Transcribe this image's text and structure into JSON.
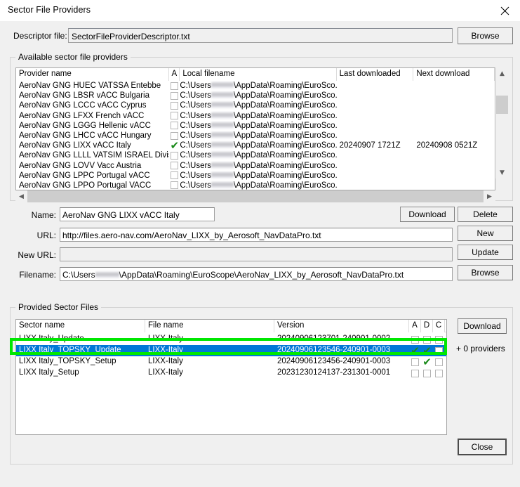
{
  "window": {
    "title": "Sector File Providers",
    "close_icon": "close-icon"
  },
  "descriptor": {
    "label": "Descriptor file:",
    "value": "SectorFileProviderDescriptor.txt",
    "browse_label": "Browse"
  },
  "available_providers": {
    "group_title": "Available sector file providers",
    "columns": [
      "Provider name",
      "A",
      "Local filename",
      "Last downloaded",
      "Next download"
    ],
    "rows": [
      {
        "name": "AeroNav GNG HUEC VATSSA Entebbe",
        "active": false,
        "path_prefix": "C:\\Users",
        "path_suffix": "\\AppData\\Roaming\\EuroSco...",
        "last_downloaded": "",
        "next_download": ""
      },
      {
        "name": "AeroNav GNG LBSR vACC Bulgaria",
        "active": false,
        "path_prefix": "C:\\Users",
        "path_suffix": "\\AppData\\Roaming\\EuroSco...",
        "last_downloaded": "",
        "next_download": ""
      },
      {
        "name": "AeroNav GNG LCCC vACC Cyprus",
        "active": false,
        "path_prefix": "C:\\Users",
        "path_suffix": "\\AppData\\Roaming\\EuroSco...",
        "last_downloaded": "",
        "next_download": ""
      },
      {
        "name": "AeroNav GNG LFXX French vACC",
        "active": false,
        "path_prefix": "C:\\Users",
        "path_suffix": "\\AppData\\Roaming\\EuroSco...",
        "last_downloaded": "",
        "next_download": ""
      },
      {
        "name": "AeroNav GNG LGGG Hellenic vACC",
        "active": false,
        "path_prefix": "C:\\Users",
        "path_suffix": "\\AppData\\Roaming\\EuroSco...",
        "last_downloaded": "",
        "next_download": ""
      },
      {
        "name": "AeroNav GNG LHCC vACC Hungary",
        "active": false,
        "path_prefix": "C:\\Users",
        "path_suffix": "\\AppData\\Roaming\\EuroSco...",
        "last_downloaded": "",
        "next_download": ""
      },
      {
        "name": "AeroNav GNG LIXX vACC Italy",
        "active": true,
        "path_prefix": "C:\\Users",
        "path_suffix": "\\AppData\\Roaming\\EuroSco...",
        "last_downloaded": "20240907 1721Z",
        "next_download": "20240908 0521Z"
      },
      {
        "name": "AeroNav GNG LLLL VATSIM ISRAEL Division",
        "active": false,
        "path_prefix": "C:\\Users",
        "path_suffix": "\\AppData\\Roaming\\EuroSco...",
        "last_downloaded": "",
        "next_download": ""
      },
      {
        "name": "AeroNav GNG LOVV Vacc Austria",
        "active": false,
        "path_prefix": "C:\\Users",
        "path_suffix": "\\AppData\\Roaming\\EuroSco...",
        "last_downloaded": "",
        "next_download": ""
      },
      {
        "name": "AeroNav GNG LPPC Portugal vACC",
        "active": false,
        "path_prefix": "C:\\Users",
        "path_suffix": "\\AppData\\Roaming\\EuroSco...",
        "last_downloaded": "",
        "next_download": ""
      },
      {
        "name": "AeroNav GNG LPPO Portugal VACC",
        "active": false,
        "path_prefix": "C:\\Users",
        "path_suffix": "\\AppData\\Roaming\\EuroSco...",
        "last_downloaded": "",
        "next_download": ""
      }
    ]
  },
  "detail_form": {
    "name_label": "Name:",
    "name_value": "AeroNav GNG LIXX vACC Italy",
    "url_label": "URL:",
    "url_value": "http://files.aero-nav.com/AeroNav_LIXX_by_Aerosoft_NavDataPro.txt",
    "new_url_label": "New URL:",
    "new_url_value": "",
    "filename_label": "Filename:",
    "filename_prefix": "C:\\Users",
    "filename_suffix": "\\AppData\\Roaming\\EuroScope\\AeroNav_LIXX_by_Aerosoft_NavDataPro.txt",
    "buttons": {
      "download": "Download",
      "delete": "Delete",
      "new": "New",
      "update": "Update",
      "browse": "Browse"
    }
  },
  "provided_sector_files": {
    "group_title": "Provided Sector Files",
    "columns": [
      "Sector name",
      "File name",
      "Version",
      "A",
      "D",
      "C"
    ],
    "rows": [
      {
        "sector_name": "LIXX Italy_Update",
        "file_name": "LIXX-Italy",
        "version": "20240906123701-240901-0002",
        "a": false,
        "d": false,
        "c": false,
        "selected": false
      },
      {
        "sector_name": "LIXX Italy_TOPSKY_Update",
        "file_name": "LIXX-Italy",
        "version": "20240906123546-240901-0003",
        "a": true,
        "d": true,
        "c": false,
        "selected": true
      },
      {
        "sector_name": "LIXX Italy_TOPSKY_Setup",
        "file_name": "LIXX-Italy",
        "version": "20240906123456-240901-0003",
        "a": false,
        "d": true,
        "c": false,
        "selected": false
      },
      {
        "sector_name": "LIXX Italy_Setup",
        "file_name": "LIXX-Italy",
        "version": "20231230124137-231301-0001",
        "a": false,
        "d": false,
        "c": false,
        "selected": false
      }
    ],
    "download_label": "Download",
    "providers_note": "+ 0 providers"
  },
  "footer": {
    "close_label": "Close"
  },
  "colors": {
    "annotation_green": "#00e701",
    "selection_blue": "#0078d7",
    "check_green": "#1a8a1a",
    "window_bg": "#f0f0f0"
  }
}
